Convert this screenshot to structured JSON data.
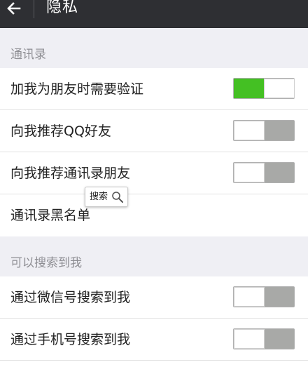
{
  "header": {
    "title": "隐私"
  },
  "sections": [
    {
      "header": "通讯录",
      "items": [
        {
          "label": "加我为朋友时需要验证",
          "toggle": "on"
        },
        {
          "label": "向我推荐QQ好友",
          "toggle": "off"
        },
        {
          "label": "向我推荐通讯录朋友",
          "toggle": "off"
        },
        {
          "label": "通讯录黑名单"
        }
      ]
    },
    {
      "header": "可以搜索到我",
      "items": [
        {
          "label": "通过微信号搜索到我",
          "toggle": "off"
        },
        {
          "label": "通过手机号搜索到我",
          "toggle": "off"
        }
      ]
    }
  ],
  "tooltip": {
    "label": "搜索"
  },
  "colors": {
    "topbar": "#2e2f33",
    "toggle_on": "#44c023",
    "toggle_off": "#a8a9a7",
    "background": "#efeff4"
  },
  "icons": {
    "back": "back-arrow-icon",
    "tooltip": "magnifier-icon"
  }
}
